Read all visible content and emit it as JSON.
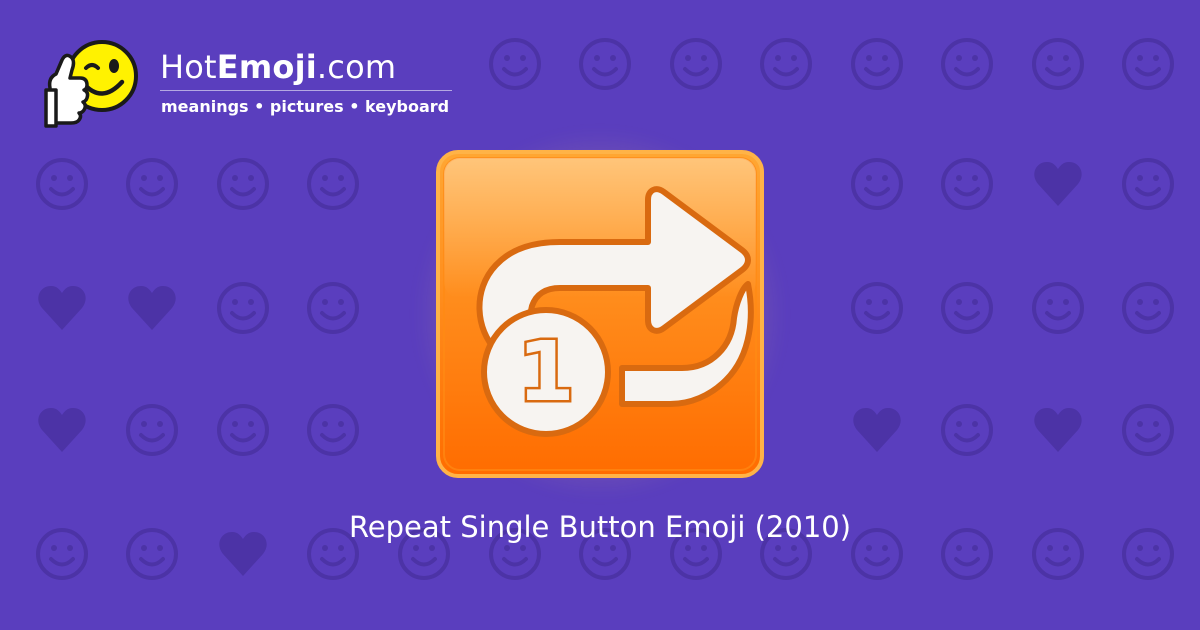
{
  "brand": {
    "name_prefix": "Hot",
    "name_bold": "Emoji",
    "name_suffix": ".com",
    "tagline": "meanings • pictures • keyboard",
    "logo_icon": "thumbs-up-winking-face-icon"
  },
  "emoji": {
    "name": "Repeat Single Button",
    "icon": "repeat-single-button-icon",
    "badge_number": "1"
  },
  "caption": "Repeat Single Button Emoji (2010)",
  "colors": {
    "background": "#5a3ebe",
    "pattern": "#4c33a6",
    "button_orange_top": "#ffa733",
    "button_orange_bottom": "#ff6c00",
    "arrow_fill": "#f7f4f1",
    "arrow_outline": "#d96a10"
  },
  "background_pattern_icons": [
    "smiling-face-icon",
    "kissing-wink-face-icon",
    "two-hearts-icon",
    "smiling-face-icon",
    "persevering-face-icon",
    "ok-hand-icon",
    "expressionless-face-icon",
    "eyes-icon",
    "unamused-face-icon",
    "relieved-face-icon",
    "grinning-teeth-face-icon",
    "recycle-icon",
    "raising-hands-person-icon",
    "music-notes-icon",
    "crying-face-icon",
    "grinning-face-icon",
    "sparkles-icon",
    "grinning-face-icon",
    "striped-heart-icon",
    "broken-heart-icon",
    "confused-face-icon",
    "striped-heart-icon",
    "tongue-wink-face-icon",
    "frowning-face-icon",
    "heart-arrow-icon",
    "weary-face-icon",
    "revolving-hearts-icon",
    "heart-icon",
    "see-no-evil-monkey-icon",
    "screaming-face-icon",
    "smiling-devil-icon",
    "angry-face-icon",
    "left-arrow-icon",
    "fire-icon",
    "confetti-icon",
    "tongue-wink-face-icon",
    "rose-icon",
    "sun-icon",
    "flexed-biceps-icon",
    "striped-heart-icon",
    "check-mark-icon",
    "grinning-squint-face-icon",
    "woman-face-icon",
    "cat-face-icon",
    "waving-hand-icon",
    "grimacing-face-icon",
    "camera-icon",
    "frowning-face-icon",
    "striped-heart-icon",
    "grinning-face-icon",
    "beating-heart-icon",
    "kissing-face-icon"
  ]
}
